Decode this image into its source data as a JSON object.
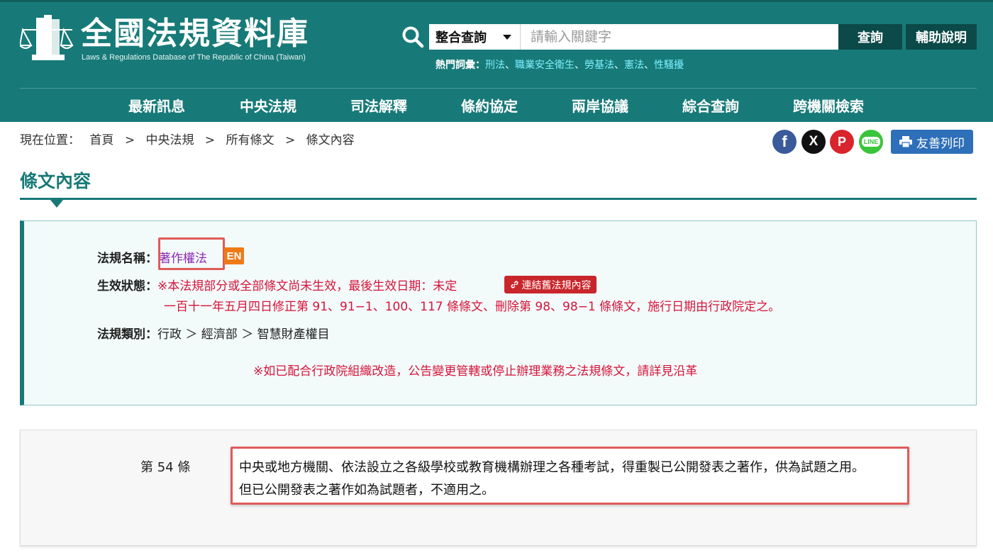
{
  "site": {
    "title": "全國法規資料庫",
    "subtitle": "Laws & Regulations Database of The Republic of China (Taiwan)",
    "logo_icon": "law-scale-logo-icon"
  },
  "search": {
    "scope_selected": "整合查詢",
    "placeholder": "請輸入關鍵字",
    "query_label": "查詢",
    "help_label": "輔助說明",
    "hot_label": "熱門詞彙：",
    "hot_terms": [
      "刑法",
      "職業安全衛生",
      "勞基法",
      "憲法",
      "性騷擾"
    ],
    "hot_separator": "、"
  },
  "nav": {
    "items": [
      "最新訊息",
      "中央法規",
      "司法解釋",
      "條約協定",
      "兩岸協議",
      "綜合查詢",
      "跨機關檢索"
    ]
  },
  "breadcrumb": {
    "prefix": "現在位置：",
    "items": [
      "首頁",
      "中央法規",
      "所有條文",
      "條文內容"
    ],
    "separator": ">"
  },
  "share": {
    "facebook": "f",
    "x": "X",
    "pinterest": "P",
    "line": "LINE",
    "print_label": "友善列印"
  },
  "page": {
    "title": "條文內容"
  },
  "law_info": {
    "name_label": "法規名稱：",
    "name": "著作權法",
    "en_badge": "EN",
    "status_label": "生效狀態：",
    "status_text": "※本法規部分或全部條文尚未生效，最後生效日期：未定",
    "old_link_label": "連結舊法規內容",
    "status_detail": "一百十一年五月四日修正第 91、91−1、100、117 條條文、刪除第 98、98−1  條條文，施行日期由行政院定之。",
    "category_label": "法規類別：",
    "category_path": "行政 ＞ 經濟部 ＞ 智慧財產權目",
    "notice": "※如已配合行政院組織改造，公告變更管轄或停止辦理業務之法規條文，請詳見沿革"
  },
  "article": {
    "number": "第 54 條",
    "lines": [
      "中央或地方機關、依法設立之各級學校或教育機構辦理之各種考試，得重製已公開發表之著作，供為試題之用。",
      "但已公開發表之著作如為試題者，不適用之。"
    ]
  },
  "colors": {
    "header_teal": "#177a78",
    "dark_teal_button": "#0b4a48",
    "hot_term_link": "#7ff0ff",
    "law_name_purple": "#8d2ab0",
    "status_red": "#d6143a",
    "highlight_box": "#e05a5a",
    "print_button_blue": "#2d6fb8",
    "en_badge_orange": "#ee7a17"
  }
}
